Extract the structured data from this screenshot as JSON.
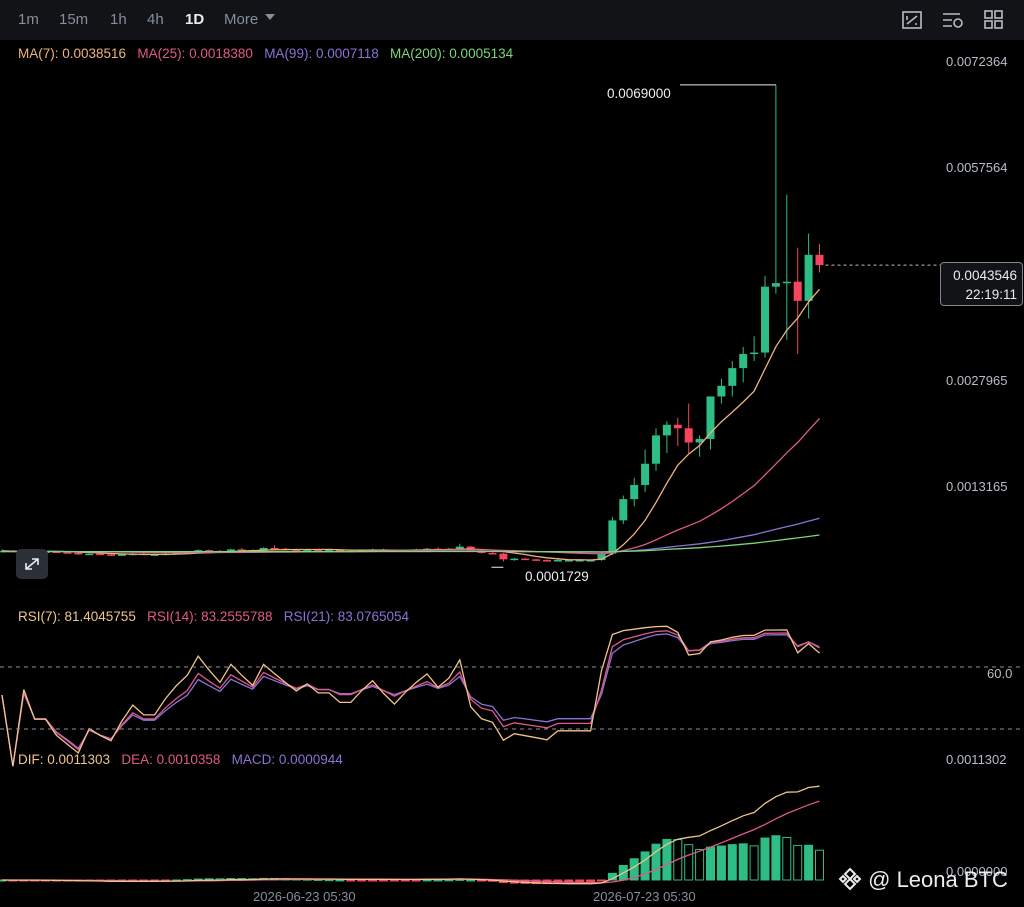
{
  "toolbar": {
    "timeframes": [
      "1m",
      "15m",
      "1h",
      "4h",
      "1D"
    ],
    "active": "1D",
    "more_label": "More",
    "icons": [
      "screenshot-icon",
      "indicator-settings-icon",
      "layout-grid-icon"
    ]
  },
  "colors": {
    "up": "#2ebd85",
    "down": "#f6465d",
    "ma7": "#f0b27a",
    "ma25": "#e0598b",
    "ma99": "#8b72d6",
    "ma200": "#7bd67b",
    "rsi7": "#f0c48a",
    "rsi14": "#e0598b",
    "rsi21": "#8b72d6",
    "dif": "#f0c48a",
    "dea": "#e0598b",
    "macd": "#8b72d6"
  },
  "ma_legend": {
    "ma7": "MA(7): 0.0038516",
    "ma25": "MA(25): 0.0018380",
    "ma99": "MA(99): 0.0007118",
    "ma200": "MA(200): 0.0005134"
  },
  "rsi_legend": {
    "rsi7": "RSI(7): 81.4045755",
    "rsi14": "RSI(14): 83.2555788",
    "rsi21": "RSI(21): 83.0765054"
  },
  "macd_legend": {
    "dif": "DIF: 0.0011303",
    "dea": "DEA: 0.0010358",
    "macd": "MACD: 0.0000944"
  },
  "price_axis": [
    "0.0072364",
    "0.0057564",
    "0.0027965",
    "0.0013165"
  ],
  "rsi_axis": [
    "60.0"
  ],
  "macd_axis": [
    "0.0011302",
    "0.0000000"
  ],
  "dates": [
    "2026-06-23 05:30",
    "2026-07-23 05:30"
  ],
  "current_price": "0.0043546",
  "countdown": "22:19:11",
  "high_label": "0.0069000",
  "low_label": "0.0001729",
  "watermark": "@ Leona BTC",
  "chart_data": {
    "type": "candlestick",
    "price_range": [
      0,
      0.0072364
    ],
    "high": 0.0069,
    "low": 0.0001729,
    "last": 0.0043546,
    "candles_ohlc": [
      [
        0.00032,
        0.00034,
        0.0003,
        0.00032
      ],
      [
        0.00032,
        0.00033,
        0.0003,
        0.00031
      ],
      [
        0.00031,
        0.00033,
        0.0003,
        0.00032
      ],
      [
        0.00032,
        0.00033,
        0.0003,
        0.00031
      ],
      [
        0.00031,
        0.00032,
        0.0003,
        0.00031
      ],
      [
        0.00031,
        0.00032,
        0.00029,
        0.0003
      ],
      [
        0.0003,
        0.00031,
        0.00028,
        0.00029
      ],
      [
        0.00029,
        0.0003,
        0.00026,
        0.00027
      ],
      [
        0.00027,
        0.00029,
        0.00026,
        0.00028
      ],
      [
        0.00028,
        0.00029,
        0.00026,
        0.00027
      ],
      [
        0.00027,
        0.00028,
        0.00025,
        0.00026
      ],
      [
        0.00026,
        0.00028,
        0.00025,
        0.00027
      ],
      [
        0.00027,
        0.00029,
        0.00026,
        0.00028
      ],
      [
        0.00028,
        0.00029,
        0.00026,
        0.00027
      ],
      [
        0.00027,
        0.00028,
        0.00026,
        0.00027
      ],
      [
        0.00027,
        0.00029,
        0.00026,
        0.00028
      ],
      [
        0.00028,
        0.0003,
        0.00027,
        0.00029
      ],
      [
        0.00029,
        0.00031,
        0.00028,
        0.0003
      ],
      [
        0.0003,
        0.00034,
        0.00029,
        0.00033
      ],
      [
        0.00033,
        0.00034,
        0.00031,
        0.00032
      ],
      [
        0.00032,
        0.00033,
        0.0003,
        0.00031
      ],
      [
        0.00031,
        0.00035,
        0.0003,
        0.00034
      ],
      [
        0.00034,
        0.00036,
        0.00032,
        0.00033
      ],
      [
        0.00033,
        0.00034,
        0.00031,
        0.00032
      ],
      [
        0.00032,
        0.00037,
        0.00031,
        0.00036
      ],
      [
        0.00036,
        0.0004,
        0.00034,
        0.00035
      ],
      [
        0.00035,
        0.00036,
        0.00033,
        0.00034
      ],
      [
        0.00034,
        0.00035,
        0.00032,
        0.00033
      ],
      [
        0.00033,
        0.00035,
        0.00032,
        0.00034
      ],
      [
        0.00034,
        0.00035,
        0.00032,
        0.00033
      ],
      [
        0.00033,
        0.00034,
        0.00032,
        0.00033
      ],
      [
        0.00033,
        0.00034,
        0.00031,
        0.00032
      ],
      [
        0.00032,
        0.00033,
        0.00031,
        0.00032
      ],
      [
        0.00032,
        0.00033,
        0.00031,
        0.00033
      ],
      [
        0.00033,
        0.00035,
        0.00032,
        0.00034
      ],
      [
        0.00034,
        0.00035,
        0.00032,
        0.00033
      ],
      [
        0.00033,
        0.00034,
        0.00031,
        0.00032
      ],
      [
        0.00032,
        0.00034,
        0.00031,
        0.00033
      ],
      [
        0.00033,
        0.00035,
        0.00032,
        0.00034
      ],
      [
        0.00034,
        0.00036,
        0.00033,
        0.00035
      ],
      [
        0.00035,
        0.00037,
        0.00033,
        0.00034
      ],
      [
        0.00034,
        0.00036,
        0.00033,
        0.00035
      ],
      [
        0.00035,
        0.00042,
        0.00034,
        0.00038
      ],
      [
        0.00038,
        0.00039,
        0.00031,
        0.00032
      ],
      [
        0.00032,
        0.00033,
        0.00028,
        0.00029
      ],
      [
        0.00029,
        0.0003,
        0.00027,
        0.00028
      ],
      [
        0.00028,
        0.00029,
        0.00017,
        0.0002
      ],
      [
        0.0002,
        0.00022,
        0.00018,
        0.00021
      ],
      [
        0.00021,
        0.00022,
        0.00019,
        0.0002
      ],
      [
        0.0002,
        0.00021,
        0.00018,
        0.00019
      ],
      [
        0.00019,
        0.0002,
        0.000173,
        0.00018
      ],
      [
        0.00018,
        0.0002,
        0.00017,
        0.00019
      ],
      [
        0.00019,
        0.0002,
        0.00018,
        0.00019
      ],
      [
        0.00019,
        0.0002,
        0.00018,
        0.00019
      ],
      [
        0.00019,
        0.0002,
        0.00017,
        0.00019
      ],
      [
        0.00019,
        0.0003,
        0.00018,
        0.00028
      ],
      [
        0.00028,
        0.0008,
        0.00026,
        0.00075
      ],
      [
        0.00075,
        0.0011,
        0.0007,
        0.00105
      ],
      [
        0.00105,
        0.00135,
        0.00095,
        0.00125
      ],
      [
        0.00125,
        0.00175,
        0.00115,
        0.00155
      ],
      [
        0.00155,
        0.00205,
        0.00145,
        0.00195
      ],
      [
        0.00195,
        0.00215,
        0.0017,
        0.0021
      ],
      [
        0.0021,
        0.0022,
        0.0018,
        0.00205
      ],
      [
        0.00205,
        0.0024,
        0.0017,
        0.00185
      ],
      [
        0.00185,
        0.00195,
        0.00165,
        0.0019
      ],
      [
        0.0019,
        0.0025,
        0.00175,
        0.0025
      ],
      [
        0.0025,
        0.00275,
        0.0024,
        0.00265
      ],
      [
        0.00265,
        0.003,
        0.0025,
        0.0029
      ],
      [
        0.0029,
        0.0032,
        0.0027,
        0.0031
      ],
      [
        0.0031,
        0.00335,
        0.003,
        0.00312
      ],
      [
        0.00312,
        0.0042,
        0.00305,
        0.00405
      ],
      [
        0.00405,
        0.0069,
        0.00395,
        0.0041
      ],
      [
        0.0041,
        0.00535,
        0.0033,
        0.00412
      ],
      [
        0.00412,
        0.0046,
        0.0031,
        0.00385
      ],
      [
        0.00385,
        0.0048,
        0.0036,
        0.0045
      ],
      [
        0.0045,
        0.00465,
        0.00425,
        0.0043546
      ]
    ],
    "ma": [
      {
        "name": "MA(7)",
        "last": 0.0038516
      },
      {
        "name": "MA(25)",
        "last": 0.001838
      },
      {
        "name": "MA(99)",
        "last": 0.0007118
      },
      {
        "name": "MA(200)",
        "last": 0.0005134
      }
    ],
    "rsi": {
      "reference": [
        60
      ],
      "last": {
        "rsi7": 81.4045755,
        "rsi14": 83.2555788,
        "rsi21": 83.0765054
      }
    },
    "macd": {
      "range": [
        0,
        0.0011302
      ],
      "last": {
        "dif": 0.0011303,
        "dea": 0.0010358,
        "macd": 9.44e-05
      }
    }
  }
}
